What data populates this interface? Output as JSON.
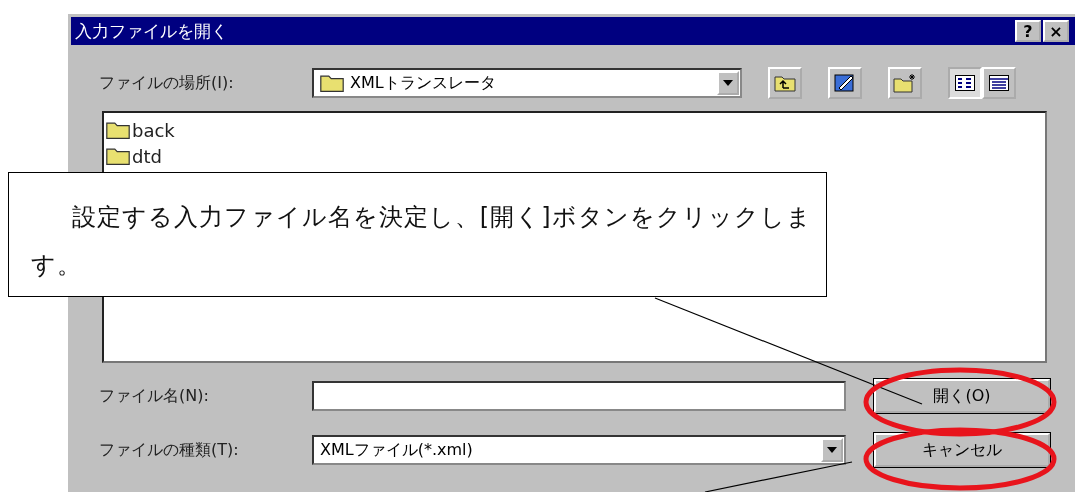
{
  "window": {
    "title": "入力ファイルを開く",
    "title_buttons": [
      "?",
      "×"
    ]
  },
  "location": {
    "label": "ファイルの場所(I):",
    "value": "XMLトランスレータ"
  },
  "views": [
    {
      "kind": "list",
      "selected": true
    },
    {
      "kind": "details",
      "selected": false
    }
  ],
  "files": [
    {
      "name": "back"
    },
    {
      "name": "dtd"
    }
  ],
  "file_name": {
    "label": "ファイル名(N):"
  },
  "file_type": {
    "label": "ファイルの種類(T):",
    "value": "XMLファイル(*.xml)"
  },
  "buttons": [
    {
      "label": "開く(O)",
      "circled": true
    },
    {
      "label": "キャンセル",
      "circled": true
    }
  ],
  "callout": {
    "text": "設定する入力ファイル名を決定し、[開く]ボタンをクリックします。"
  }
}
